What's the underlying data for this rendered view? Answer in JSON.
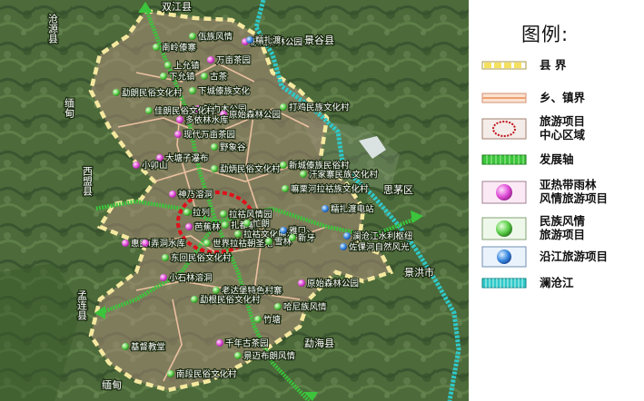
{
  "legend": {
    "title": "图例:",
    "items": [
      {
        "label": "县 界"
      },
      {
        "label": "乡、镇界"
      },
      {
        "label": "旅游项目\n中心区域"
      },
      {
        "label": "发展轴"
      },
      {
        "label": "亚热带雨林\n风情旅游项目"
      },
      {
        "label": "民族风情\n旅游项目"
      },
      {
        "label": "沿江旅游项目"
      },
      {
        "label": "澜沧江"
      }
    ]
  },
  "map": {
    "counties": [
      {
        "name": "双江县"
      },
      {
        "name": "景谷县"
      },
      {
        "name": "沧源县"
      },
      {
        "name": "缅甸"
      },
      {
        "name": "西盟县"
      },
      {
        "name": "思茅区"
      },
      {
        "name": "景洪市"
      },
      {
        "name": "孟连县"
      },
      {
        "name": "勐海县"
      },
      {
        "name": "缅甸"
      }
    ],
    "projects": [
      {
        "name": "佤族风情",
        "type": "ethnic"
      },
      {
        "name": "南岭傣寨",
        "type": "ethnic"
      },
      {
        "name": "原始森林公园",
        "type": "rainforest"
      },
      {
        "name": "上允镇",
        "type": "ethnic"
      },
      {
        "name": "万亩茶园",
        "type": "rainforest"
      },
      {
        "name": "下允镇",
        "type": "ethnic"
      },
      {
        "name": "糯扎渡",
        "type": "river"
      },
      {
        "name": "古茶",
        "type": "ethnic"
      },
      {
        "name": "下城傣族文化",
        "type": "ethnic"
      },
      {
        "name": "铁力木公园",
        "type": "rainforest"
      },
      {
        "name": "勐朗民俗文化村",
        "type": "ethnic"
      },
      {
        "name": "佳朗民俗文化村",
        "type": "ethnic"
      },
      {
        "name": "原始森林公园",
        "type": "rainforest"
      },
      {
        "name": "打鸡民族文化村",
        "type": "ethnic"
      },
      {
        "name": "多依林水库",
        "type": "rainforest"
      },
      {
        "name": "现代万亩茶园",
        "type": "rainforest"
      },
      {
        "name": "野象谷",
        "type": "ethnic"
      },
      {
        "name": "大塘子瀑布",
        "type": "rainforest"
      },
      {
        "name": "小卯山",
        "type": "rainforest"
      },
      {
        "name": "勐炳民俗文化村",
        "type": "ethnic"
      },
      {
        "name": "新城傣族民俗村",
        "type": "ethnic"
      },
      {
        "name": "汗家寨民族文化村",
        "type": "ethnic"
      },
      {
        "name": "嘛栗河拉祜族文化村",
        "type": "ethnic"
      },
      {
        "name": "神乃溶洞",
        "type": "rainforest"
      },
      {
        "name": "拉祜风情园",
        "type": "ethnic"
      },
      {
        "name": "糯扎渡电站",
        "type": "river"
      },
      {
        "name": "扎都寨",
        "type": "ethnic"
      },
      {
        "name": "拉祜文化展示中心",
        "type": "ethnic"
      },
      {
        "name": "世界拉祜朝圣地",
        "type": "ethnic"
      },
      {
        "name": "澜沧江水利枢纽",
        "type": "river"
      },
      {
        "name": "惠民山",
        "type": "rainforest"
      },
      {
        "name": "佐倮河自然风光",
        "type": "river"
      },
      {
        "name": "弄洞水库",
        "type": "rainforest"
      },
      {
        "name": "芭蕉林",
        "type": "rainforest"
      },
      {
        "name": "拉列",
        "type": "ethnic"
      },
      {
        "name": "雪林",
        "type": "ethnic"
      },
      {
        "name": "雅口",
        "type": "river"
      },
      {
        "name": "忙朗",
        "type": "ethnic"
      },
      {
        "name": "新牙",
        "type": "ethnic"
      },
      {
        "name": "东回民俗文化村",
        "type": "ethnic"
      },
      {
        "name": "小石林溶洞",
        "type": "rainforest"
      },
      {
        "name": "原始森林公园",
        "type": "rainforest"
      },
      {
        "name": "老达堡特色村寨",
        "type": "ethnic"
      },
      {
        "name": "勐根民俗文化村",
        "type": "ethnic"
      },
      {
        "name": "哈尼族风情",
        "type": "ethnic"
      },
      {
        "name": "竹塘",
        "type": "ethnic"
      },
      {
        "name": "基督教堂",
        "type": "ethnic"
      },
      {
        "name": "千年古茶园",
        "type": "rainforest"
      },
      {
        "name": "景迈布朗风情",
        "type": "ethnic"
      },
      {
        "name": "南段民俗文化村",
        "type": "ethnic"
      }
    ]
  },
  "colors": {
    "county_border": "#f5e9a0",
    "town_border": "#f7c8a8",
    "center_area": "#e0101a",
    "axis_green": "#3cc43c",
    "river": "#2fc8c8",
    "rainforest_dot": "#e050d8",
    "ethnic_dot": "#5cd04a",
    "river_dot": "#3a8ae0"
  }
}
